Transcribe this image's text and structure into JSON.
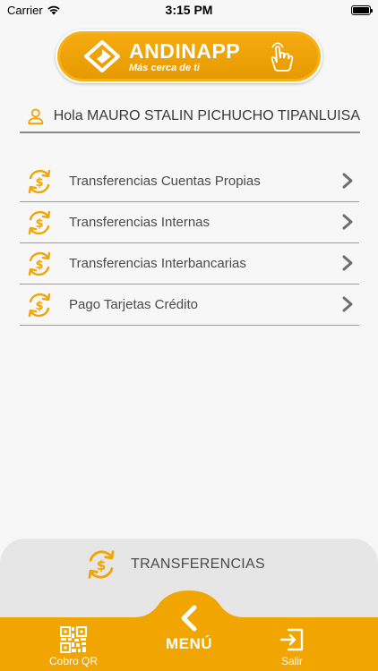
{
  "status_bar": {
    "carrier": "Carrier",
    "time": "3:15 PM",
    "wifi_icon": "wifi-icon",
    "battery_icon": "battery-icon"
  },
  "logo": {
    "name": "ANDINAPP",
    "tagline": "Más cerca de ti"
  },
  "greeting": {
    "text": "Hola MAURO STALIN PICHUCHO TIPANLUISA",
    "icon": "user-icon"
  },
  "menu": {
    "items": [
      {
        "label": "Transferencias Cuentas Propias",
        "icon": "transfer-dollar-icon"
      },
      {
        "label": "Transferencias Internas",
        "icon": "transfer-dollar-icon"
      },
      {
        "label": "Transferencias Interbancarias",
        "icon": "transfer-dollar-icon"
      },
      {
        "label": "Pago Tarjetas Crédito",
        "icon": "transfer-dollar-icon"
      }
    ]
  },
  "section": {
    "title": "TRANSFERENCIAS"
  },
  "tabbar": {
    "qr_label": "Cobro QR",
    "menu_label": "MENÚ",
    "exit_label": "Salir"
  },
  "colors": {
    "accent": "#f0a500",
    "accent_dark": "#e69a00",
    "text": "#3a3a3a",
    "background": "#f7f7f7",
    "panel": "#e6e6e6"
  }
}
